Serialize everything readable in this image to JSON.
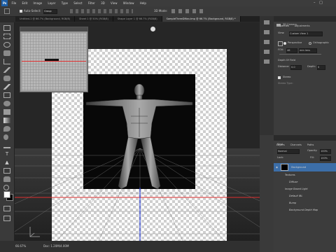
{
  "app": {
    "logo": "Ps"
  },
  "menu": [
    "File",
    "Edit",
    "Image",
    "Layer",
    "Type",
    "Select",
    "Filter",
    "3D",
    "View",
    "Window",
    "Help"
  ],
  "options": {
    "auto_select_label": "Auto-Select:",
    "auto_select_value": "Group",
    "mode_label": "3D Mode:",
    "workspace": "3D"
  },
  "tabs": [
    {
      "label": "Untitled-1 @ 66.7% (Background, RGB/8)",
      "active": false
    },
    {
      "label": "Sheet 1 @ 50% (RGB/8)",
      "active": false
    },
    {
      "label": "Shape Layer 1 @ 66.7% (RGB/8)",
      "active": false
    },
    {
      "label": "SampleThreeDMan.tmp @ 66.7% (Background, RGB/8) *",
      "active": true
    }
  ],
  "status": {
    "zoom": "66.67%",
    "doc": "Doc: 1.20M/4.00M"
  },
  "properties": {
    "tabs": [
      "Properties",
      "Adjustments"
    ],
    "section_title": "3D Camera",
    "view_label": "View:",
    "view_value": "Custom View 1",
    "perspective_label": "Perspective",
    "orthographic_label": "Orthographic",
    "fov_label": "FOV:",
    "fov_value": "46",
    "fov_unit": "mm lens",
    "dof_label": "Depth Of Field",
    "distance_label": "Distance:",
    "distance_value": "0.0",
    "depth_label": "Depth:",
    "depth_value": "0",
    "stereo_label": "Stereo",
    "stereo_type": "Stereo Type:"
  },
  "layers": {
    "tabs": [
      "Layers",
      "Channels",
      "Paths"
    ],
    "kind_label": "Kind",
    "blend_mode": "Normal",
    "opacity_label": "Opacity:",
    "opacity_value": "100%",
    "lock_label": "Lock:",
    "fill_label": "Fill:",
    "fill_value": "100%",
    "items": [
      {
        "name": "Background",
        "selected": true
      },
      {
        "name": "Textures",
        "selected": false
      },
      {
        "name": "Diffuse",
        "selected": false
      },
      {
        "name": "Image Based Light",
        "selected": false
      },
      {
        "name": "Default IBL",
        "selected": false
      },
      {
        "name": "Bump",
        "selected": false
      },
      {
        "name": "Background Depth Map",
        "selected": false
      }
    ]
  }
}
